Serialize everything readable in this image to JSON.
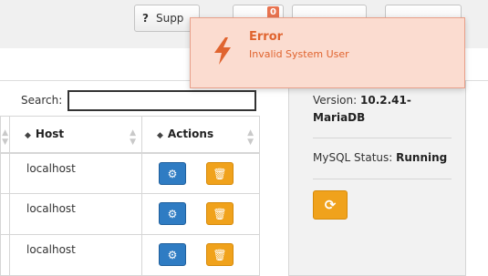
{
  "topbar": {
    "support_label": "Supp",
    "support_icon": "question-mark-icon",
    "notification_count": "0"
  },
  "search": {
    "label": "Search:",
    "value": ""
  },
  "table": {
    "headers": {
      "host": "Host",
      "actions": "Actions"
    },
    "rows": [
      {
        "host": "localhost"
      },
      {
        "host": "localhost"
      },
      {
        "host": "localhost"
      }
    ]
  },
  "server_info": {
    "version_label": "Version:",
    "version_value": "10.2.41-MariaDB",
    "status_label": "MySQL Status:",
    "status_value": "Running"
  },
  "toast": {
    "title": "Error",
    "message": "Invalid System User",
    "icon": "lightning-bolt-icon",
    "color": "#e0642f"
  },
  "colors": {
    "primary_button": "#2f7cc3",
    "warning_button": "#f0a21c",
    "toast_background": "#fbdcd0"
  }
}
